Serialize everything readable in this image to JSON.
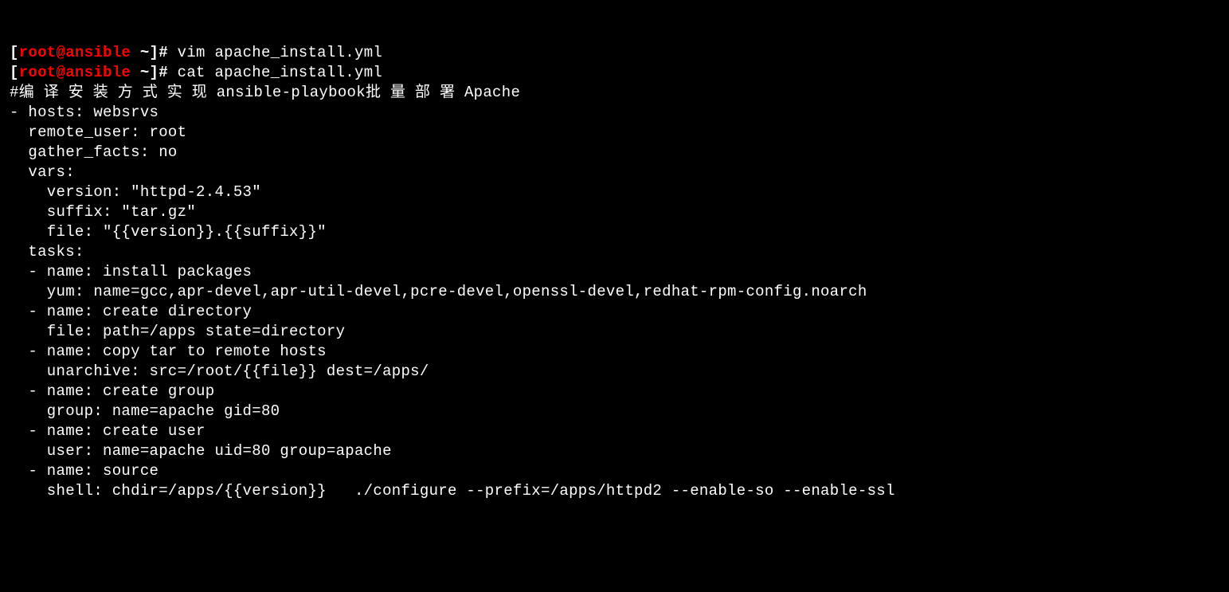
{
  "prompt1": {
    "bracket_open": "[",
    "user": "root",
    "at": "@",
    "host": "ansible",
    "space": " ",
    "tilde": "~",
    "bracket_close": "]",
    "hash": "# ",
    "command": "vim apache_install.yml"
  },
  "prompt2": {
    "bracket_open": "[",
    "user": "root",
    "at": "@",
    "host": "ansible",
    "space": " ",
    "tilde": "~",
    "bracket_close": "]",
    "hash": "# ",
    "command": "cat apache_install.yml"
  },
  "lines": {
    "l01": "#编 译 安 装 方 式 实 现 ansible-playbook批 量 部 署 Apache",
    "l02": "- hosts: websrvs",
    "l03": "  remote_user: root",
    "l04": "  gather_facts: no",
    "l05": "  vars:",
    "l06": "    version: \"httpd-2.4.53\"",
    "l07": "    suffix: \"tar.gz\"",
    "l08": "    file: \"{{version}}.{{suffix}}\"",
    "l09": "",
    "l10": "  tasks:",
    "l11": "  - name: install packages",
    "l12": "    yum: name=gcc,apr-devel,apr-util-devel,pcre-devel,openssl-devel,redhat-rpm-config.noarch",
    "l13": "",
    "l14": "  - name: create directory",
    "l15": "    file: path=/apps state=directory",
    "l16": "",
    "l17": "  - name: copy tar to remote hosts",
    "l18": "    unarchive: src=/root/{{file}} dest=/apps/",
    "l19": "",
    "l20": "  - name: create group",
    "l21": "    group: name=apache gid=80",
    "l22": "",
    "l23": "  - name: create user",
    "l24": "    user: name=apache uid=80 group=apache",
    "l25": "",
    "l26": "  - name: source",
    "l27": "    shell: chdir=/apps/{{version}}   ./configure --prefix=/apps/httpd2 --enable-so --enable-ssl"
  }
}
